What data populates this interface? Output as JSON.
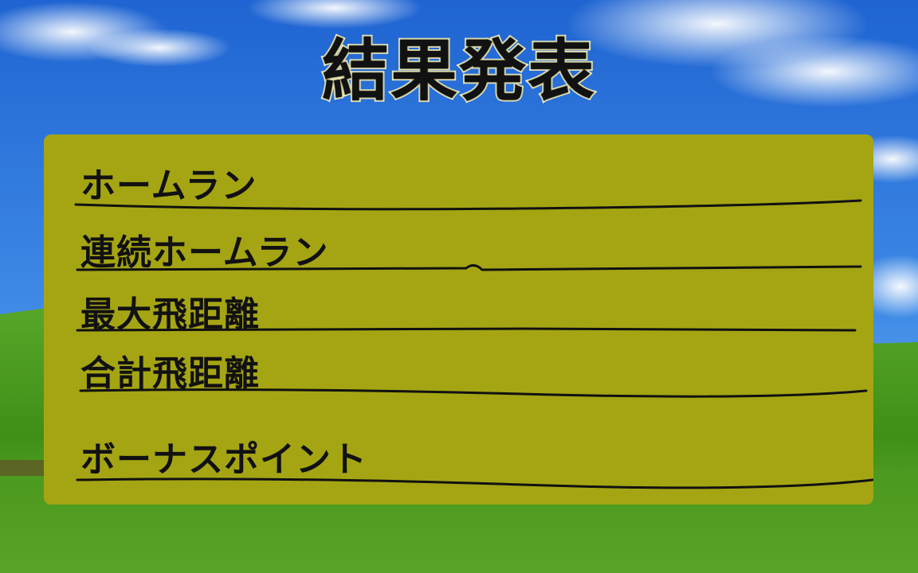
{
  "screen": {
    "title": "結果発表",
    "rows": [
      {
        "label": "ホームラン"
      },
      {
        "label": "連続ホームラン"
      },
      {
        "label": "最大飛距離"
      },
      {
        "label": "合計飛距離"
      },
      {
        "label": "ボーナスポイント"
      }
    ]
  },
  "colors": {
    "panel": "#a5a513",
    "title_outline": "#f2f0c8",
    "sky": "#2e78d8",
    "grass": "#3f8f18"
  }
}
